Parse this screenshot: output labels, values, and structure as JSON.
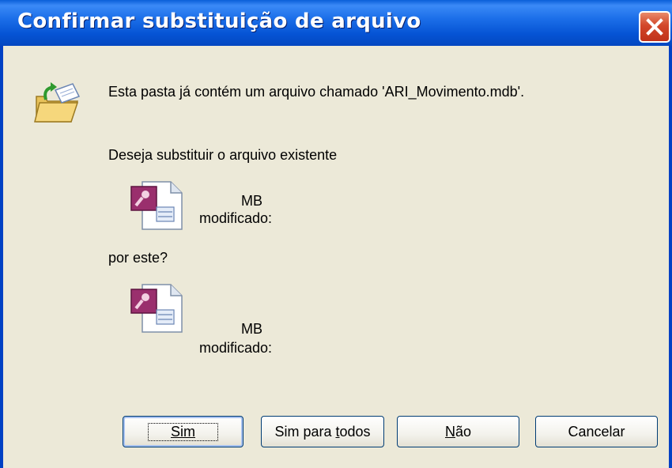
{
  "dialog": {
    "title": "Confirmar substituição de arquivo",
    "message": "Esta pasta já contém um arquivo chamado 'ARI_Movimento.mdb'.",
    "question": "Deseja substituir o arquivo existente",
    "by_this": "por este?",
    "existing_file": {
      "size": "MB",
      "modified": "modificado:"
    },
    "new_file": {
      "size": "MB",
      "modified": "modificado:"
    }
  },
  "buttons": {
    "yes": "Sim",
    "yes_all_prefix": "Sim para ",
    "yes_all_mnemonic": "t",
    "yes_all_suffix": "odos",
    "no_mnemonic": "N",
    "no_suffix": "ão",
    "cancel": "Cancelar"
  },
  "icons": {
    "folder": "folder-replace-icon",
    "file": "access-database-file-icon",
    "close": "close-icon"
  },
  "colors": {
    "titlebar": "#0553d4",
    "dialog_bg": "#ece9d8",
    "close_button": "#d2472a",
    "button_border": "#003c74"
  }
}
